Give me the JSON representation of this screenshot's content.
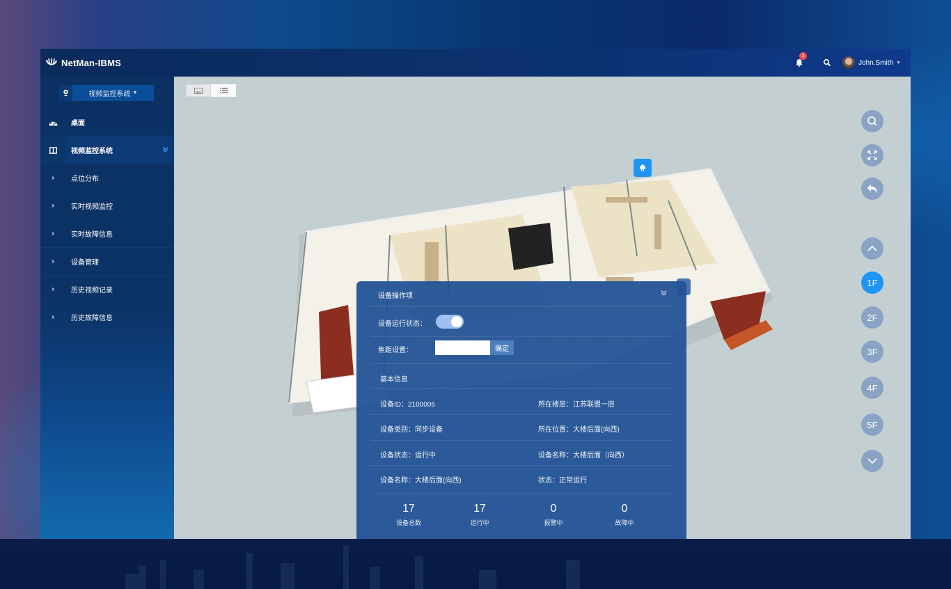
{
  "header": {
    "app_title": "NetMan-IBMS",
    "notification_count": "3",
    "username": "John.Smith"
  },
  "sidebar": {
    "system_selector": "视频监控系统",
    "items": [
      {
        "label": "桌面",
        "icon": "dashboard-icon",
        "level": "top"
      },
      {
        "label": "视频监控系统",
        "icon": "columns-icon",
        "level": "top",
        "active": true
      },
      {
        "label": "点位分布",
        "icon": "chevron-right-icon",
        "level": "sub"
      },
      {
        "label": "实时视频监控",
        "icon": "chevron-right-icon",
        "level": "sub"
      },
      {
        "label": "实时故障信息",
        "icon": "chevron-right-icon",
        "level": "sub"
      },
      {
        "label": "设备管理",
        "icon": "chevron-right-icon",
        "level": "sub"
      },
      {
        "label": "历史视频记录",
        "icon": "chevron-right-icon",
        "level": "sub"
      },
      {
        "label": "历史故障信息",
        "icon": "chevron-right-icon",
        "level": "sub"
      }
    ]
  },
  "toolbar": {
    "view_modes": [
      "image-view",
      "list-view"
    ],
    "tools": [
      "search",
      "fullscreen",
      "back"
    ]
  },
  "floors": {
    "labels": [
      "1F",
      "2F",
      "3F",
      "4F",
      "5F"
    ],
    "active": "1F"
  },
  "panel": {
    "title": "设备操作项",
    "run_state_label": "设备运行状态：",
    "run_state_on": true,
    "focus_label": "焦距设置：",
    "focus_value": "",
    "confirm_label": "确定",
    "basic_info_title": "基本信息",
    "info": [
      {
        "label": "设备ID：",
        "value": "2100006"
      },
      {
        "label": "所在楼层：",
        "value": "江苏联盟一层"
      },
      {
        "label": "设备类别：",
        "value": "同步设备"
      },
      {
        "label": "所在位置：",
        "value": "大楼后面(向西)"
      },
      {
        "label": "设备状态：",
        "value": "运行中"
      },
      {
        "label": "设备名称：",
        "value": "大楼后面（向西）"
      },
      {
        "label": "设备名称：",
        "value": "大楼后面(向西)"
      },
      {
        "label": "状态：",
        "value": "正常运行"
      }
    ],
    "stats": [
      {
        "value": "17",
        "label": "设备总数"
      },
      {
        "value": "17",
        "label": "运行中"
      },
      {
        "value": "0",
        "label": "报警中"
      },
      {
        "value": "0",
        "label": "故障中"
      }
    ]
  },
  "colors": {
    "accent": "#1e94f5",
    "panel": "#235296",
    "floor_button": "#8aa3c4",
    "badge": "#f24b4b"
  }
}
